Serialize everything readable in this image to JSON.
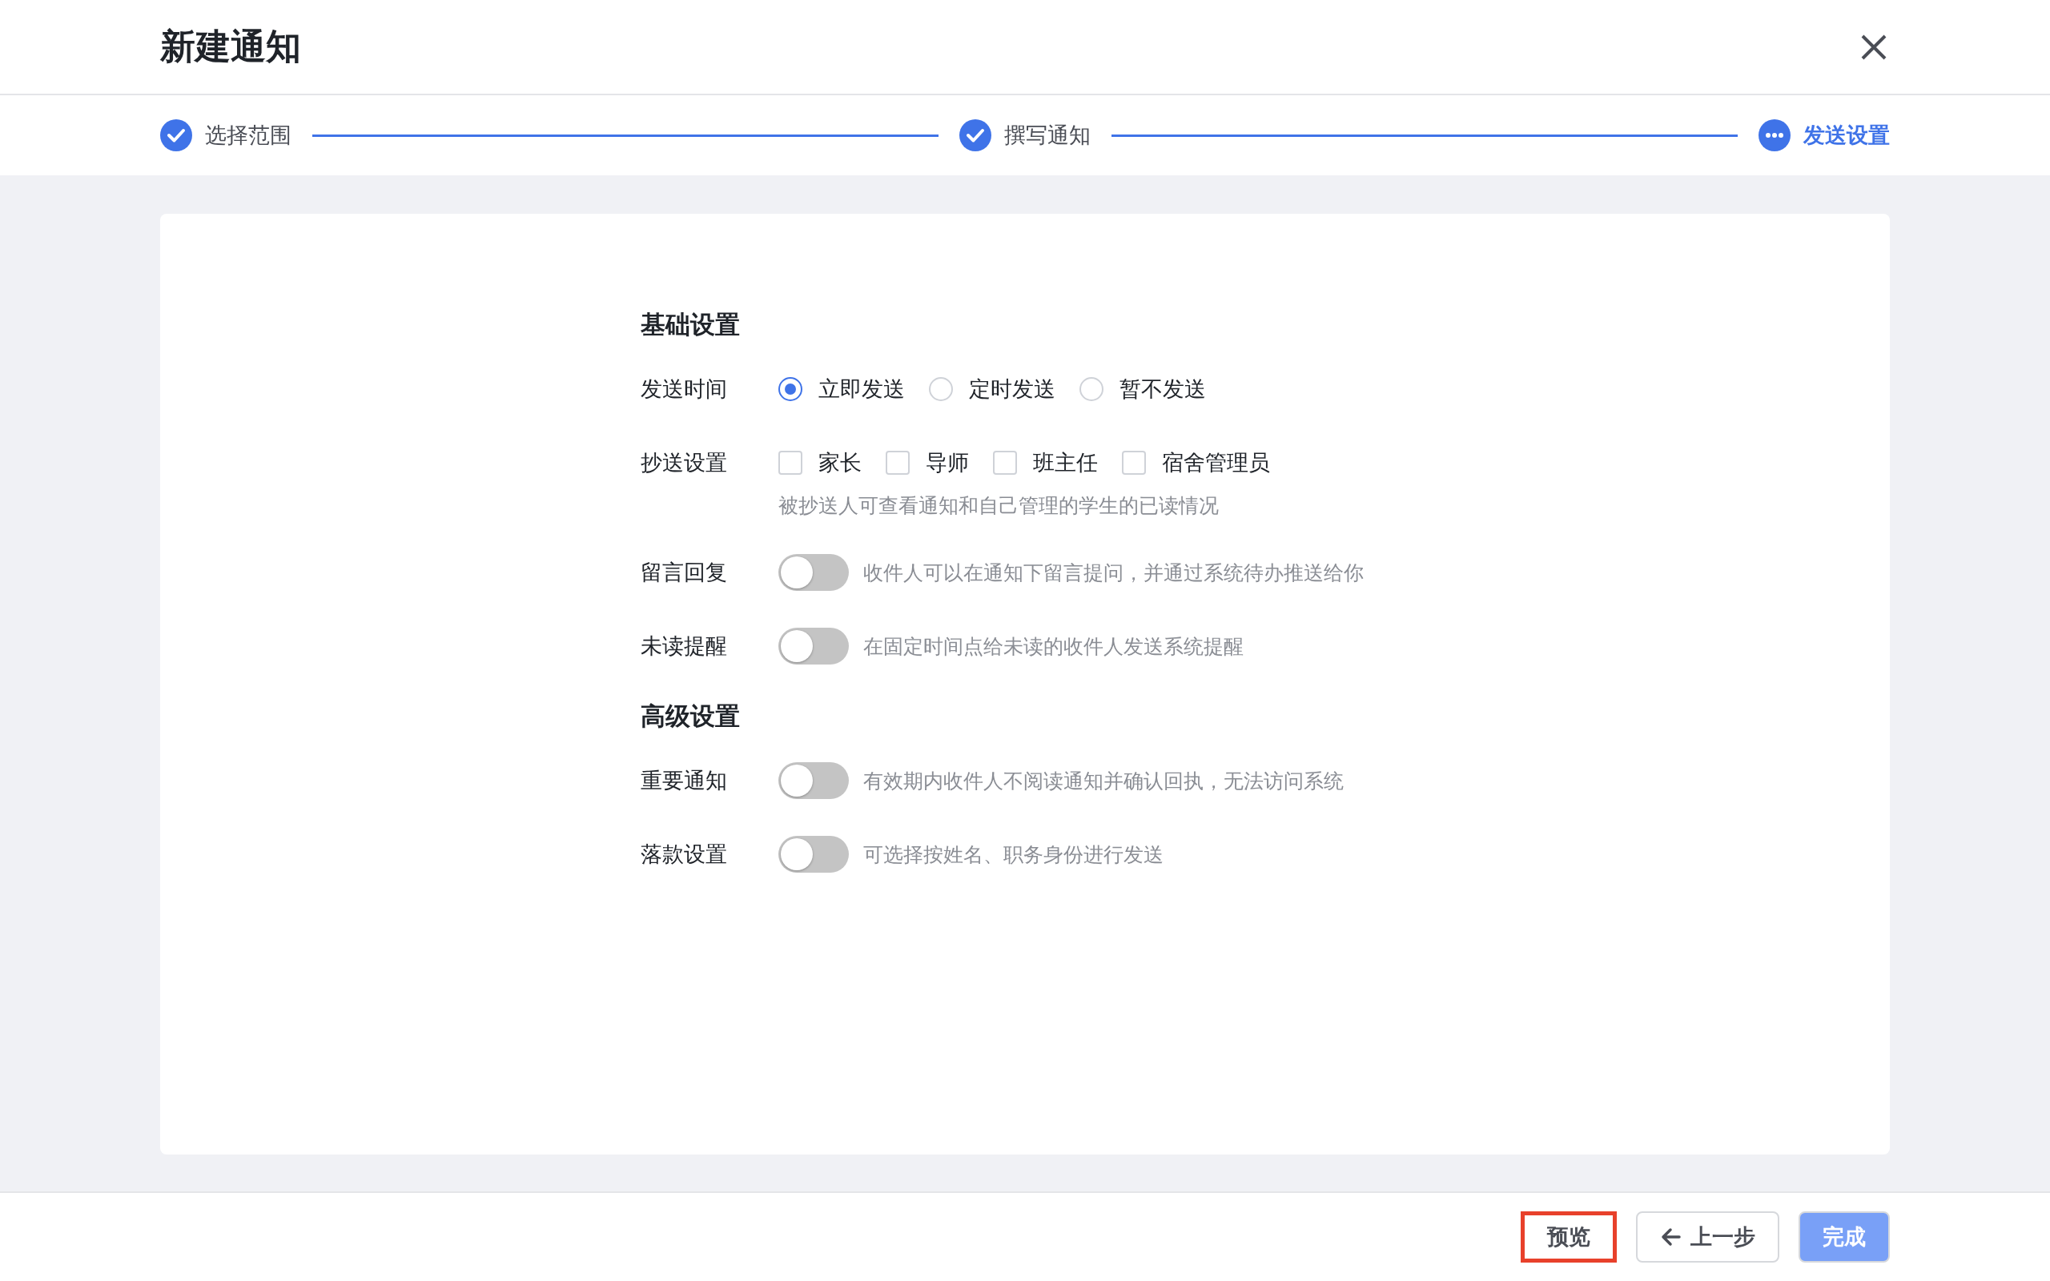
{
  "title": "新建通知",
  "steps": [
    {
      "label": "选择范围",
      "done": true,
      "selected": false
    },
    {
      "label": "撰写通知",
      "done": true,
      "selected": false
    },
    {
      "label": "发送设置",
      "done": false,
      "selected": true
    }
  ],
  "sections": [
    {
      "title": "基础设置",
      "rows": [
        {
          "kind": "radio",
          "label": "发送时间",
          "options": [
            {
              "label": "立即发送",
              "selected": true
            },
            {
              "label": "定时发送",
              "selected": false
            },
            {
              "label": "暂不发送",
              "selected": false
            }
          ]
        },
        {
          "kind": "checkbox",
          "label": "抄送设置",
          "options": [
            {
              "label": "家长",
              "checked": false
            },
            {
              "label": "导师",
              "checked": false
            },
            {
              "label": "班主任",
              "checked": false
            },
            {
              "label": "宿舍管理员",
              "checked": false
            }
          ],
          "hint": "被抄送人可查看通知和自己管理的学生的已读情况"
        },
        {
          "kind": "toggle",
          "label": "留言回复",
          "on": false,
          "description": "收件人可以在通知下留言提问，并通过系统待办推送给你"
        },
        {
          "kind": "toggle",
          "label": "未读提醒",
          "on": false,
          "description": "在固定时间点给未读的收件人发送系统提醒"
        }
      ]
    },
    {
      "title": "高级设置",
      "rows": [
        {
          "kind": "toggle",
          "label": "重要通知",
          "on": false,
          "description": "有效期内收件人不阅读通知并确认回执，无法访问系统"
        },
        {
          "kind": "toggle",
          "label": "落款设置",
          "on": false,
          "description": "可选择按姓名、职务身份进行发送"
        }
      ]
    }
  ],
  "buttons": [
    {
      "kind": "plain",
      "label": "预览",
      "highlighted": true
    },
    {
      "kind": "back",
      "label": "上一步",
      "highlighted": false
    },
    {
      "kind": "primary",
      "label": "完成",
      "highlighted": false
    }
  ]
}
